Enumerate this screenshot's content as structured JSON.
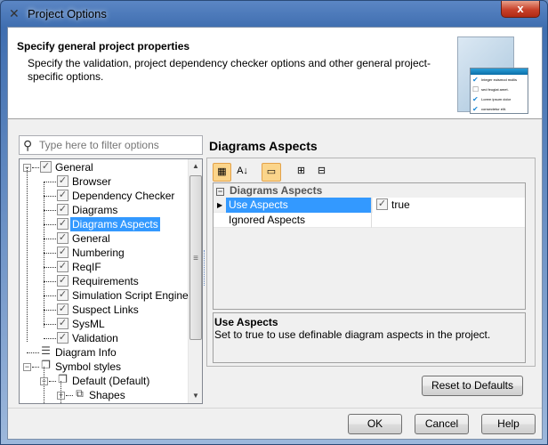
{
  "window": {
    "title": "Project Options",
    "close": "x"
  },
  "header": {
    "title": "Specify general project properties",
    "description": "Specify the validation, project dependency checker options and other general project-specific options.",
    "illustration_items": [
      "Integer euismod mollis",
      "sed feugiat amet.",
      "Lorem ipsum dolor",
      "consectetur elit."
    ]
  },
  "filter": {
    "placeholder": "Type here to filter options",
    "value": ""
  },
  "tree": [
    {
      "label": "General",
      "level": 0,
      "expander": "-",
      "icon": "check",
      "checked": true
    },
    {
      "label": "Browser",
      "level": 1,
      "icon": "check"
    },
    {
      "label": "Dependency Checker",
      "level": 1,
      "icon": "check"
    },
    {
      "label": "Diagrams",
      "level": 1,
      "icon": "check"
    },
    {
      "label": "Diagrams Aspects",
      "level": 1,
      "icon": "check",
      "selected": true
    },
    {
      "label": "General",
      "level": 1,
      "icon": "check"
    },
    {
      "label": "Numbering",
      "level": 1,
      "icon": "check"
    },
    {
      "label": "ReqIF",
      "level": 1,
      "icon": "check"
    },
    {
      "label": "Requirements",
      "level": 1,
      "icon": "check"
    },
    {
      "label": "Simulation Script Engine",
      "level": 1,
      "icon": "check"
    },
    {
      "label": "Suspect Links",
      "level": 1,
      "icon": "check"
    },
    {
      "label": "SysML",
      "level": 1,
      "icon": "check"
    },
    {
      "label": "Validation",
      "level": 1,
      "icon": "check"
    },
    {
      "label": "Diagram Info",
      "level": 0,
      "icon": "list"
    },
    {
      "label": "Symbol styles",
      "level": 0,
      "expander": "-",
      "icon": "styles"
    },
    {
      "label": "Default (Default)",
      "level": 1,
      "expander": "-",
      "icon": "styles"
    },
    {
      "label": "Shapes",
      "level": 2,
      "expander": "+",
      "icon": "shapes"
    }
  ],
  "panel": {
    "title": "Diagrams Aspects",
    "grid": {
      "category": "Diagrams Aspects",
      "rows": [
        {
          "name": "Use Aspects",
          "value": "true",
          "checked": true,
          "selected": true
        },
        {
          "name": "Ignored Aspects",
          "value": ""
        }
      ]
    },
    "description": {
      "title": "Use Aspects",
      "text": "Set to true to use definable diagram aspects in the project."
    },
    "reset_label": "Reset to Defaults"
  },
  "buttons": {
    "ok": "OK",
    "cancel": "Cancel",
    "help": "Help"
  }
}
